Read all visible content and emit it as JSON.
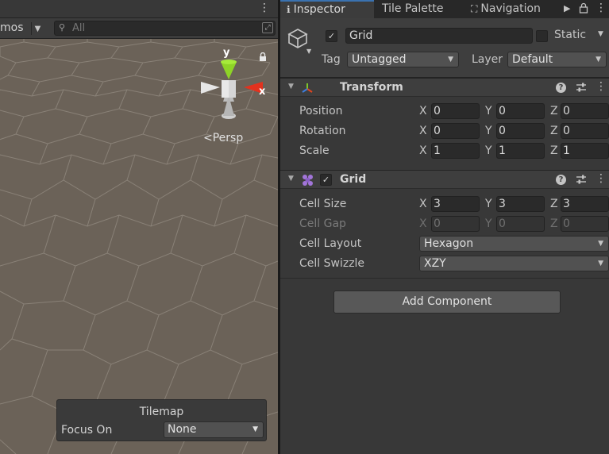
{
  "scene": {
    "gizmos_label": "mos",
    "search": {
      "placeholder": "All"
    },
    "axis_labels": {
      "y": "y",
      "x": "x"
    },
    "projection_label": "Persp",
    "overlay": {
      "title": "Tilemap",
      "focus_label": "Focus On",
      "focus_value": "None"
    }
  },
  "inspector": {
    "tabs": [
      {
        "label": "Inspector",
        "icon": "info-icon",
        "active": true
      },
      {
        "label": "Tile Palette",
        "active": false
      },
      {
        "label": "Navigation",
        "icon": "navigation-icon",
        "active": false
      }
    ],
    "header": {
      "active": true,
      "name": "Grid",
      "static_label": "Static",
      "static": false,
      "tag_label": "Tag",
      "tag_value": "Untagged",
      "layer_label": "Layer",
      "layer_value": "Default"
    },
    "transform": {
      "title": "Transform",
      "rows": [
        {
          "label": "Position",
          "x": "0",
          "y": "0",
          "z": "0"
        },
        {
          "label": "Rotation",
          "x": "0",
          "y": "0",
          "z": "0"
        },
        {
          "label": "Scale",
          "x": "1",
          "y": "1",
          "z": "1"
        }
      ]
    },
    "grid": {
      "title": "Grid",
      "enabled": true,
      "cell_size": {
        "label": "Cell Size",
        "x": "3",
        "y": "3",
        "z": "3"
      },
      "cell_gap": {
        "label": "Cell Gap",
        "x": "0",
        "y": "0",
        "z": "0"
      },
      "cell_layout": {
        "label": "Cell Layout",
        "value": "Hexagon"
      },
      "cell_swizzle": {
        "label": "Cell Swizzle",
        "value": "XZY"
      }
    },
    "add_component_label": "Add Component",
    "axis_letters": {
      "x": "X",
      "y": "Y",
      "z": "Z"
    }
  }
}
